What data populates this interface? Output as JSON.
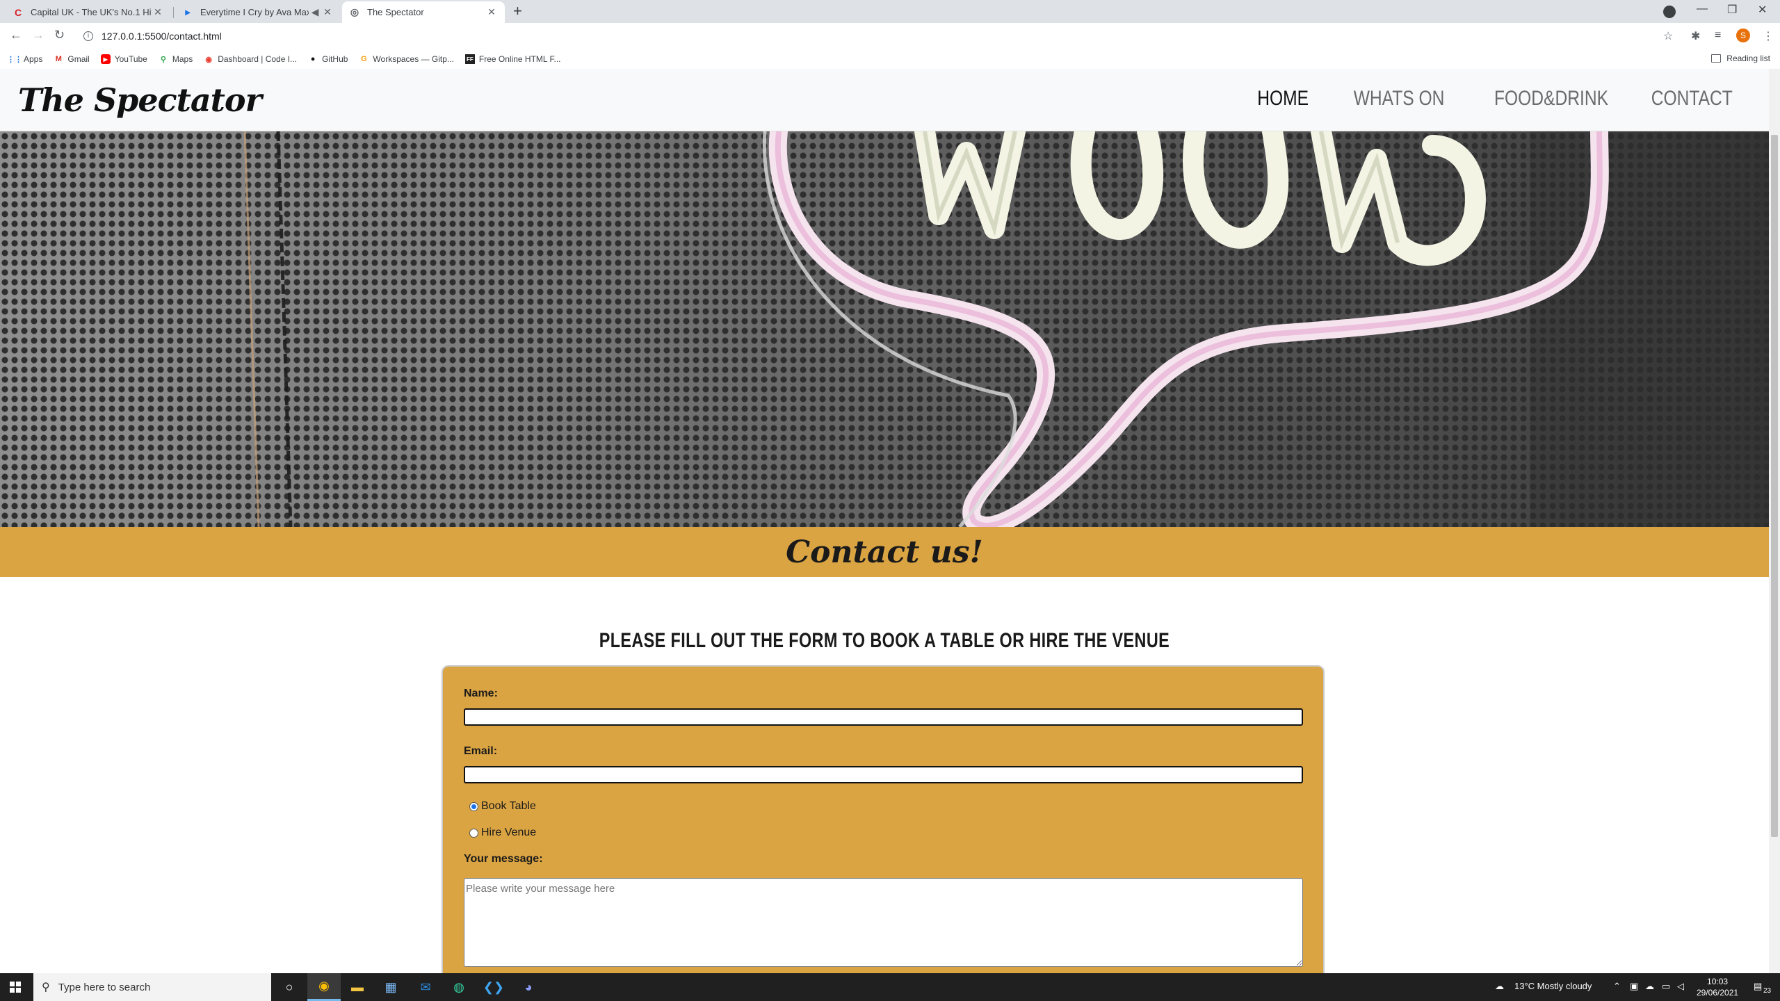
{
  "browser": {
    "tabs": [
      {
        "title": "Capital UK - The UK's No.1 Hit M",
        "favicon": "capital-icon"
      },
      {
        "title": "Everytime I Cry by Ava Max |",
        "favicon": "deezer-icon"
      },
      {
        "title": "The Spectator",
        "favicon": "globe-icon"
      }
    ],
    "url": "127.0.0.1:5500/contact.html",
    "bookmarks": [
      {
        "label": "Apps"
      },
      {
        "label": "Gmail"
      },
      {
        "label": "YouTube"
      },
      {
        "label": "Maps"
      },
      {
        "label": "Dashboard | Code I..."
      },
      {
        "label": "GitHub"
      },
      {
        "label": "Workspaces — Gitp..."
      },
      {
        "label": "Free Online HTML F..."
      }
    ],
    "reading_list": "Reading list",
    "profile_initial": "S"
  },
  "site": {
    "logo": "The Spectator",
    "nav": [
      "HOME",
      "WHATS ON",
      "FOOD&DRINK",
      "CONTACT"
    ],
    "banner_title": "Contact us!",
    "form_heading": "PLEASE FILL OUT THE FORM TO BOOK A TABLE OR HIRE THE VENUE",
    "form": {
      "name_label": "Name:",
      "email_label": "Email:",
      "options": [
        "Book Table",
        "Hire Venue"
      ],
      "selected_option": "Book Table",
      "message_label": "Your message:",
      "message_placeholder": "Please write your message here"
    }
  },
  "taskbar": {
    "search_placeholder": "Type here to search",
    "weather": "13°C  Mostly cloudy",
    "time": "10:03",
    "date": "29/06/2021",
    "notification_count": "23"
  },
  "colors": {
    "accent": "#dba443",
    "header_bg": "#f8f9fa",
    "taskbar_bg": "#202020"
  }
}
